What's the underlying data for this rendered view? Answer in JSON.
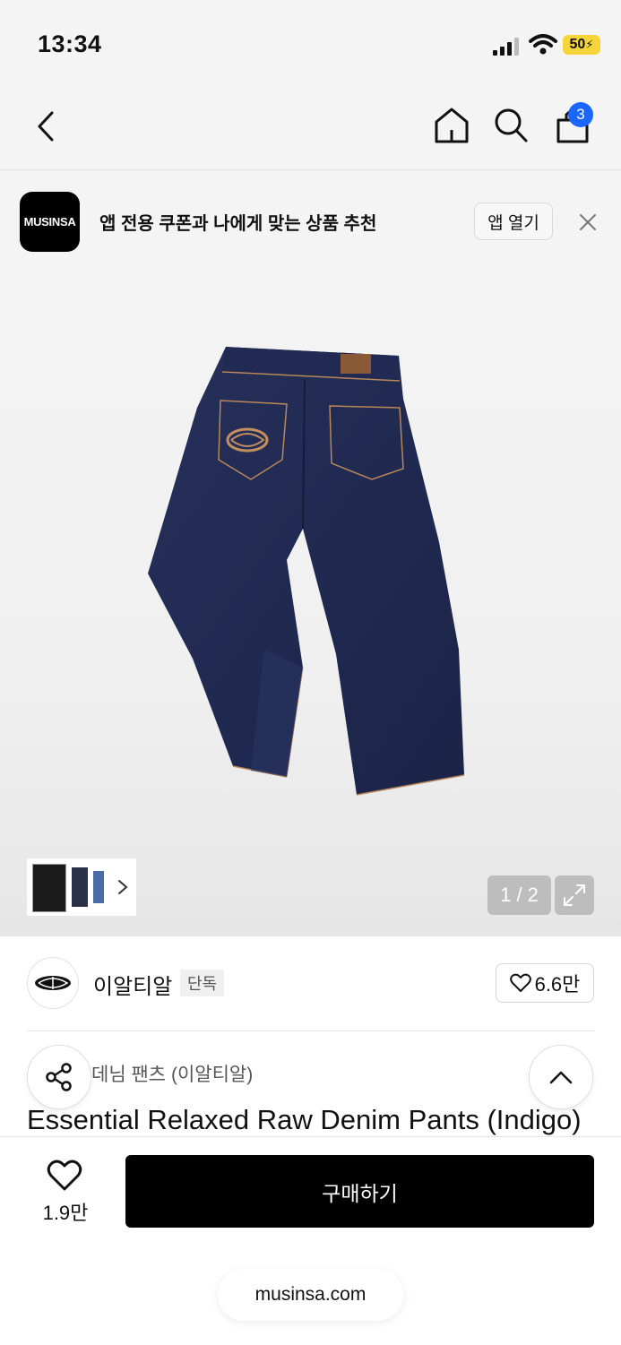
{
  "status_bar": {
    "time": "13:34",
    "battery": "50"
  },
  "nav": {
    "cart_count": "3"
  },
  "banner": {
    "logo_text": "MUSINSA",
    "message": "앱 전용 쿠폰과 나에게 맞는 상품 추천",
    "open_app_label": "앱 열기"
  },
  "gallery": {
    "counter": "1 / 2"
  },
  "brand": {
    "name": "이알티알",
    "exclusive_tag": "단독",
    "likes": "6.6만"
  },
  "product": {
    "category": "데님 팬츠 (이알티알)",
    "title": "Essential Relaxed Raw Denim Pants (Indigo)"
  },
  "bottom_bar": {
    "likes": "1.9만",
    "buy_label": "구매하기"
  },
  "browser": {
    "url": "musinsa.com"
  },
  "colors": {
    "badge": "#1a66ff",
    "buy_button": "#000000",
    "denim": "#1e2a52",
    "battery": "#f5d53a"
  }
}
